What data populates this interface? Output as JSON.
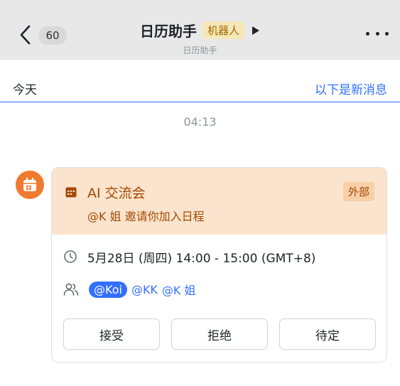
{
  "header": {
    "unread_count": "60",
    "title": "日历助手",
    "bot_tag": "机器人",
    "subtitle": "日历助手"
  },
  "divider": {
    "today": "今天",
    "new_messages": "以下是新消息"
  },
  "message": {
    "timestamp": "04:13"
  },
  "card": {
    "title": "AI 交流会",
    "badge": "外部",
    "invite": "@K 姐 邀请你加入日程",
    "time": "5月28日 (周四) 14:00 - 15:00 (GMT+8)",
    "attendees": [
      "@Koi",
      "@KK",
      "@K 姐"
    ],
    "actions": [
      "接受",
      "拒绝",
      "待定"
    ]
  },
  "colors": {
    "accent": "#3370ff",
    "avatar": "#f07a2f",
    "card_header": "#fbe4cd",
    "card_header_text": "#a34800"
  },
  "icons": {
    "back": "chevron-left-icon",
    "play": "triangle-right-icon",
    "more": "more-dots-icon",
    "avatar": "calendar-icon",
    "header": "calendar-icon",
    "time": "clock-icon",
    "people": "people-icon"
  }
}
